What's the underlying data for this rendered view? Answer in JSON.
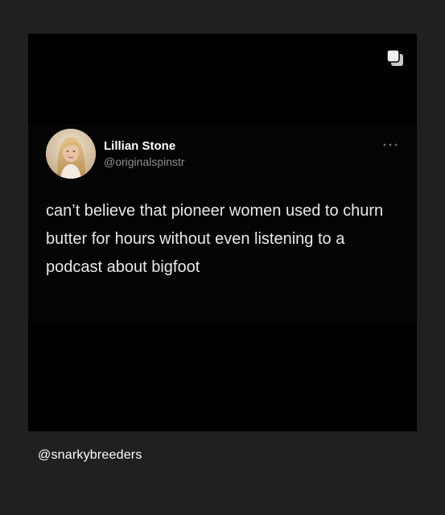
{
  "post": {
    "multi_image_icon": "carousel-icon",
    "tweet": {
      "author": {
        "name": "Lillian Stone",
        "handle": "@originalspinstr",
        "avatar_icon": "profile-photo"
      },
      "more_icon": "more-dots-icon",
      "text": "can’t believe that pioneer women used to churn butter for hours without even listening to a podcast about bigfoot"
    }
  },
  "caption": {
    "account": "@snarkybreeders"
  }
}
